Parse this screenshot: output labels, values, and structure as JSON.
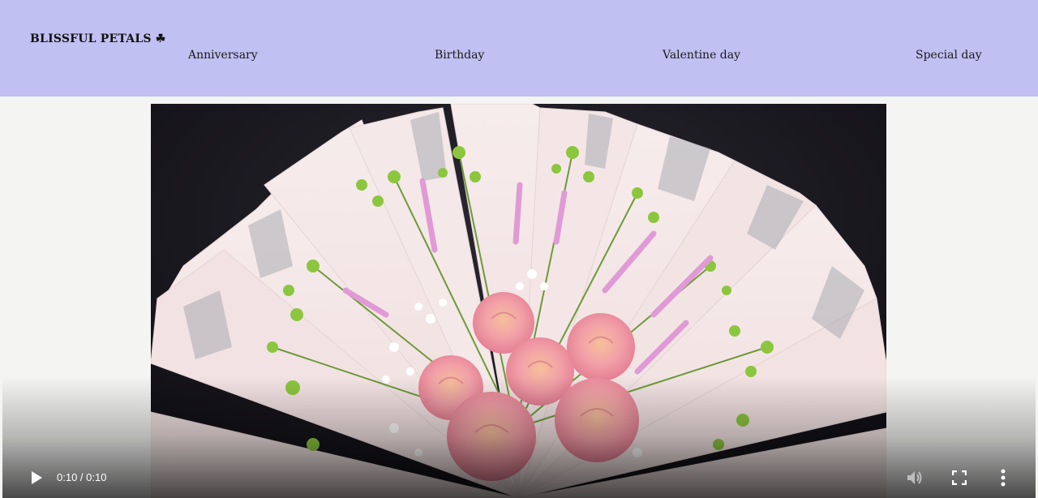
{
  "header": {
    "brand": "BLISSFUL PETALS ☘",
    "nav": [
      {
        "label": "Anniversary"
      },
      {
        "label": "Birthday"
      },
      {
        "label": "Valentine day"
      },
      {
        "label": "Special day"
      }
    ]
  },
  "video": {
    "current_time": "0:10",
    "separator": " / ",
    "duration": "0:10",
    "icons": [
      "play-icon",
      "volume-icon",
      "fullscreen-icon",
      "more-options-icon"
    ]
  }
}
